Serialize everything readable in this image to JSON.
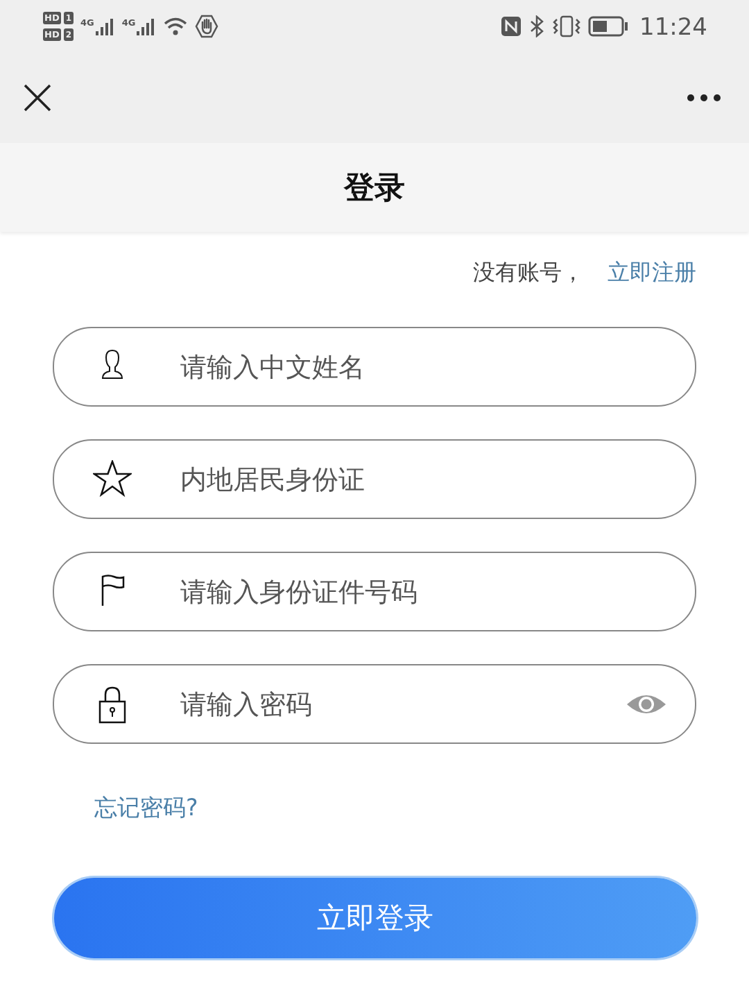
{
  "status_bar": {
    "sim_badges": [
      {
        "label": "HD",
        "slot": "1"
      },
      {
        "label": "HD",
        "slot": "2"
      }
    ],
    "networks": [
      "4G",
      "4G"
    ],
    "time": "11:24"
  },
  "nav": {
    "title": "登录"
  },
  "register": {
    "prompt": "没有账号，",
    "link": "立即注册"
  },
  "fields": [
    {
      "kind": "text",
      "placeholder": "请输入中文姓名"
    },
    {
      "kind": "select",
      "placeholder": "内地居民身份证"
    },
    {
      "kind": "text",
      "placeholder": "请输入身份证件号码"
    },
    {
      "kind": "password",
      "placeholder": "请输入密码"
    }
  ],
  "forgot": "忘记密码?",
  "submit": "立即登录"
}
